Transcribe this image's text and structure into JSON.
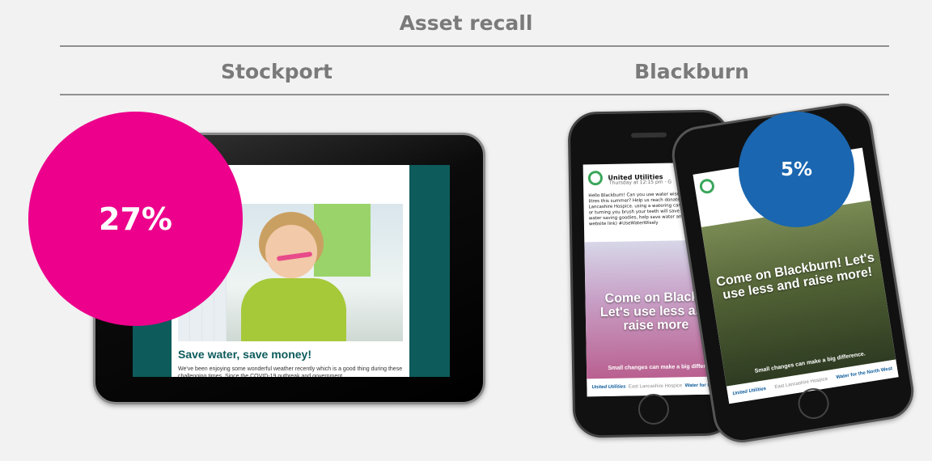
{
  "title": "Asset recall",
  "columns": {
    "left": "Stockport",
    "right": "Blackburn"
  },
  "stockport": {
    "recall": "27%",
    "recall_color": "#ec008c",
    "email": {
      "heading": "Save water, save money!",
      "body": "We've been enjoying some wonderful weather recently which is a good thing during these challenging times. Since the COVID-19 outbreak and government"
    }
  },
  "blackburn": {
    "recall": "5%",
    "recall_color": "#1a66b0",
    "post": {
      "page_name": "United Utilities",
      "timestamp": "Thursday at 12:15 pm · G",
      "text": "Hello Blackburn! Can you use water wisely 100 million litres this summer? Help us reach donate £25,000 to East Lancashire Hospice. using a watering can in the garden, or turning you brush your teeth will save 10 litres a day. water saving goodies, help save water and m (Blackburn website link) #UseWaterWisely",
      "overlay_back": "Come on Blackb Let's use less and raise more",
      "overlay_front": "Come on Blackburn! Let's use less and raise more!",
      "small_back": "Small changes can make a big differ",
      "small_front": "Small changes can make a big difference.",
      "footer_logo": "United Utilities",
      "footer_hospice": "East Lancashire Hospice",
      "footer_tagline_back": "Water for the N",
      "footer_tagline_front": "Water for the North West"
    }
  }
}
